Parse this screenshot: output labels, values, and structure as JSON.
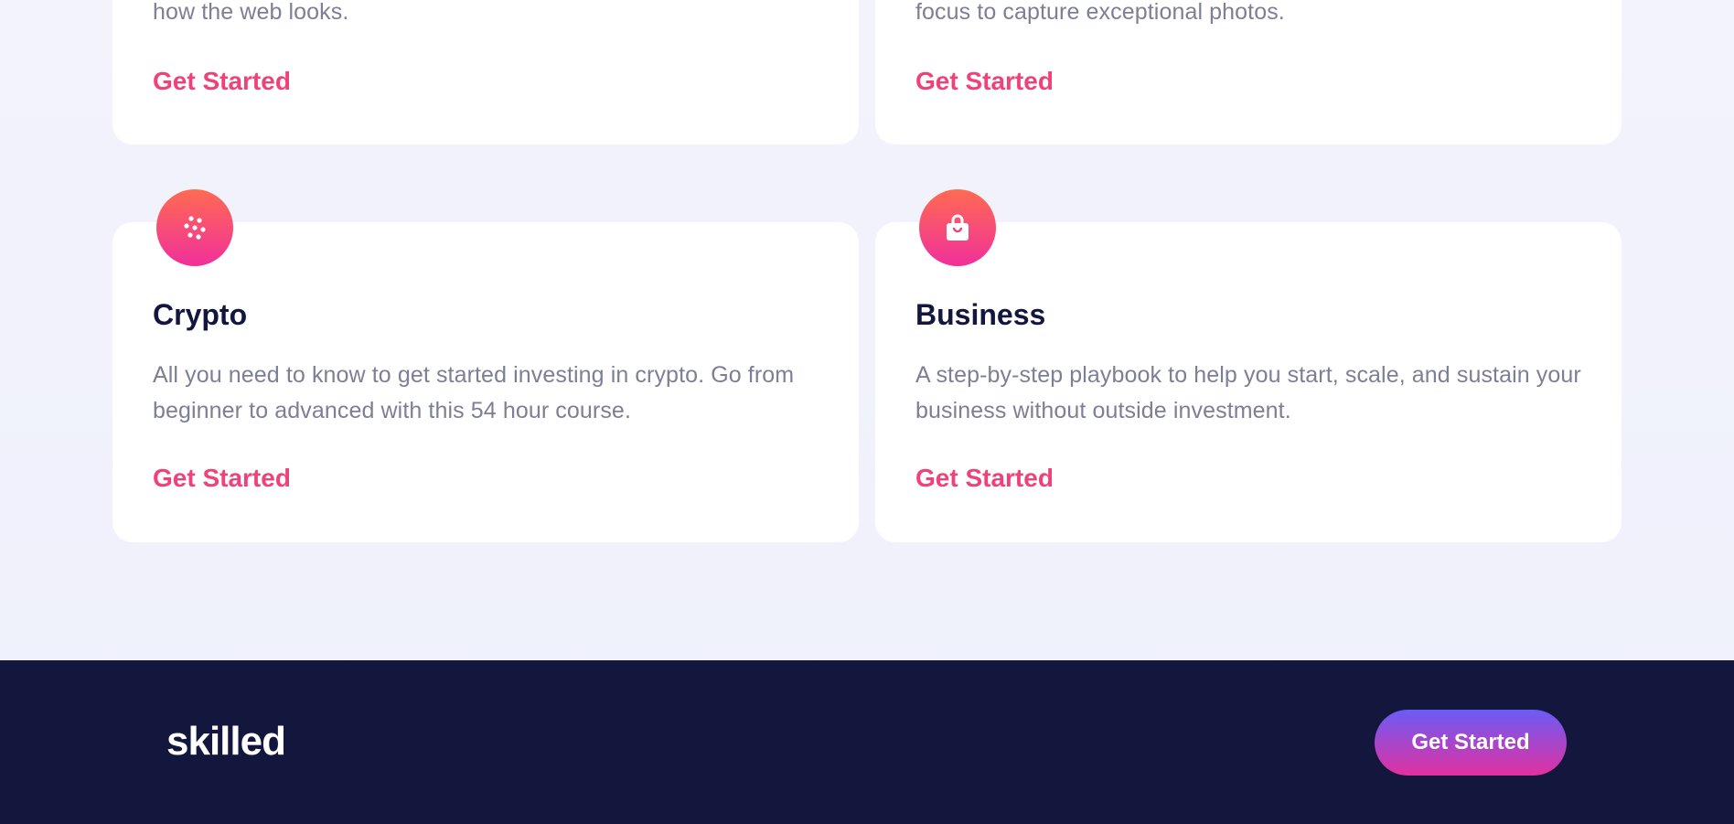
{
  "cards_top": [
    {
      "description": "how the web looks.",
      "link_label": "Get Started"
    },
    {
      "description": "focus to capture exceptional photos.",
      "link_label": "Get Started"
    }
  ],
  "cards": [
    {
      "icon": "crypto-dots-icon",
      "title": "Crypto",
      "description": "All you need to know to get started investing in crypto. Go from beginner to advanced with this 54 hour course.",
      "link_label": "Get Started"
    },
    {
      "icon": "shopping-bag-icon",
      "title": "Business",
      "description": "A step-by-step playbook to help you start, scale, and sustain your business without outside investment.",
      "link_label": "Get Started"
    }
  ],
  "footer": {
    "logo": "skilled",
    "cta_label": "Get Started"
  },
  "colors": {
    "accent": "#f0427a",
    "footer_bg": "#13173e",
    "title": "#13173d",
    "body_text": "#7c7f95"
  }
}
